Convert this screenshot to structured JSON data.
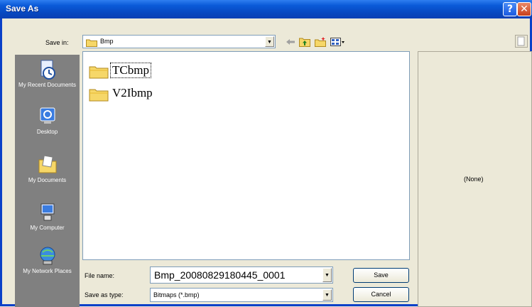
{
  "window": {
    "title": "Save As",
    "help_glyph": "?",
    "close_glyph": "✕"
  },
  "toolbar": {
    "save_in_label": "Save in:",
    "save_in_value": "Bmp",
    "icons": [
      "back-arrow-icon",
      "up-folder-icon",
      "new-folder-icon",
      "views-menu-icon"
    ]
  },
  "places": [
    {
      "label": "My Recent Documents",
      "icon": "recent-documents-icon"
    },
    {
      "label": "Desktop",
      "icon": "desktop-icon"
    },
    {
      "label": "My Documents",
      "icon": "my-documents-icon"
    },
    {
      "label": "My Computer",
      "icon": "my-computer-icon"
    },
    {
      "label": "My Network Places",
      "icon": "network-places-icon"
    }
  ],
  "files": [
    {
      "name": "TCbmp",
      "type": "folder"
    },
    {
      "name": "V2Ibmp",
      "type": "folder"
    }
  ],
  "preview": {
    "text": "(None)"
  },
  "form": {
    "file_name_label": "File name:",
    "file_name_value": "Bmp_20080829180445_0001",
    "save_type_label": "Save as type:",
    "save_type_value": "Bitmaps (*.bmp)"
  },
  "buttons": {
    "save": "Save",
    "cancel": "Cancel"
  },
  "colors": {
    "titlebar": "#0a5ad8",
    "places_bar": "#808080",
    "dialog_bg": "#ece9d8"
  }
}
